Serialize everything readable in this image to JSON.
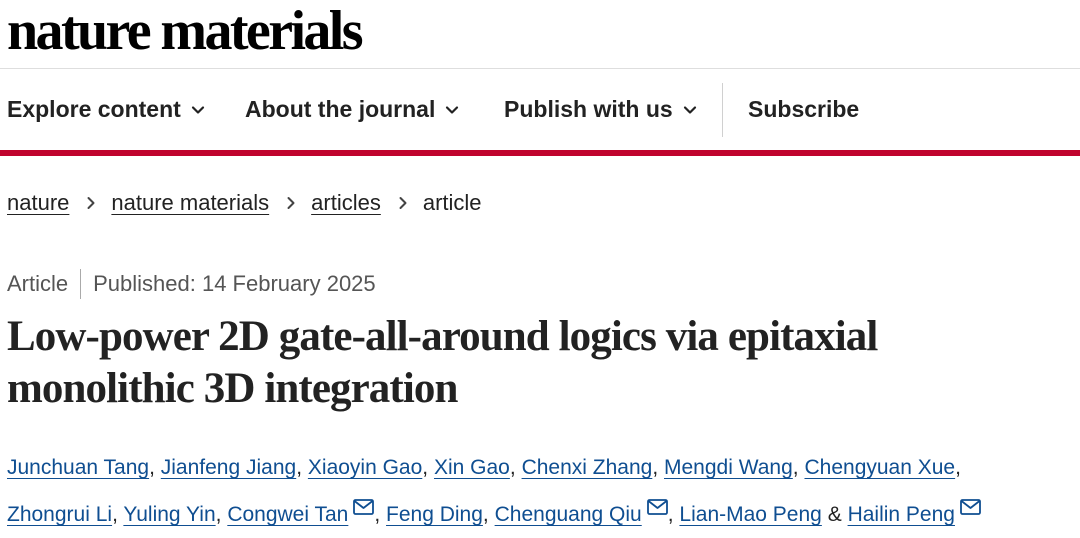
{
  "logo": {
    "text": "nature materials"
  },
  "nav": {
    "items": [
      {
        "label": "Explore content",
        "dropdown": true
      },
      {
        "label": "About the journal",
        "dropdown": true
      },
      {
        "label": "Publish with us",
        "dropdown": true
      },
      {
        "label": "Subscribe",
        "dropdown": false
      }
    ],
    "accent_color": "#c0042e"
  },
  "breadcrumb": {
    "items": [
      {
        "label": "nature",
        "link": true
      },
      {
        "label": "nature materials",
        "link": true
      },
      {
        "label": "articles",
        "link": true
      },
      {
        "label": "article",
        "link": false
      }
    ]
  },
  "meta": {
    "type": "Article",
    "published": "Published: 14 February 2025"
  },
  "article": {
    "title_line1": "Low-power 2D gate-all-around logics via epitaxial",
    "title_line2": "monolithic 3D integration"
  },
  "authors": {
    "list": [
      {
        "name": "Junchuan Tang",
        "corresponding": false
      },
      {
        "name": "Jianfeng Jiang",
        "corresponding": false
      },
      {
        "name": "Xiaoyin Gao",
        "corresponding": false
      },
      {
        "name": "Xin Gao",
        "corresponding": false
      },
      {
        "name": "Chenxi Zhang",
        "corresponding": false
      },
      {
        "name": "Mengdi Wang",
        "corresponding": false
      },
      {
        "name": "Chengyuan Xue",
        "corresponding": false
      },
      {
        "name": "Zhongrui Li",
        "corresponding": false
      },
      {
        "name": "Yuling Yin",
        "corresponding": false
      },
      {
        "name": "Congwei Tan",
        "corresponding": true
      },
      {
        "name": "Feng Ding",
        "corresponding": false
      },
      {
        "name": "Chenguang Qiu",
        "corresponding": true
      },
      {
        "name": "Lian-Mao Peng",
        "corresponding": false
      },
      {
        "name": "Hailin Peng",
        "corresponding": true
      }
    ],
    "separator": ",",
    "final_separator": "&",
    "link_color": "#0f4e91",
    "icons": {
      "corresponding": "mail-icon"
    }
  }
}
